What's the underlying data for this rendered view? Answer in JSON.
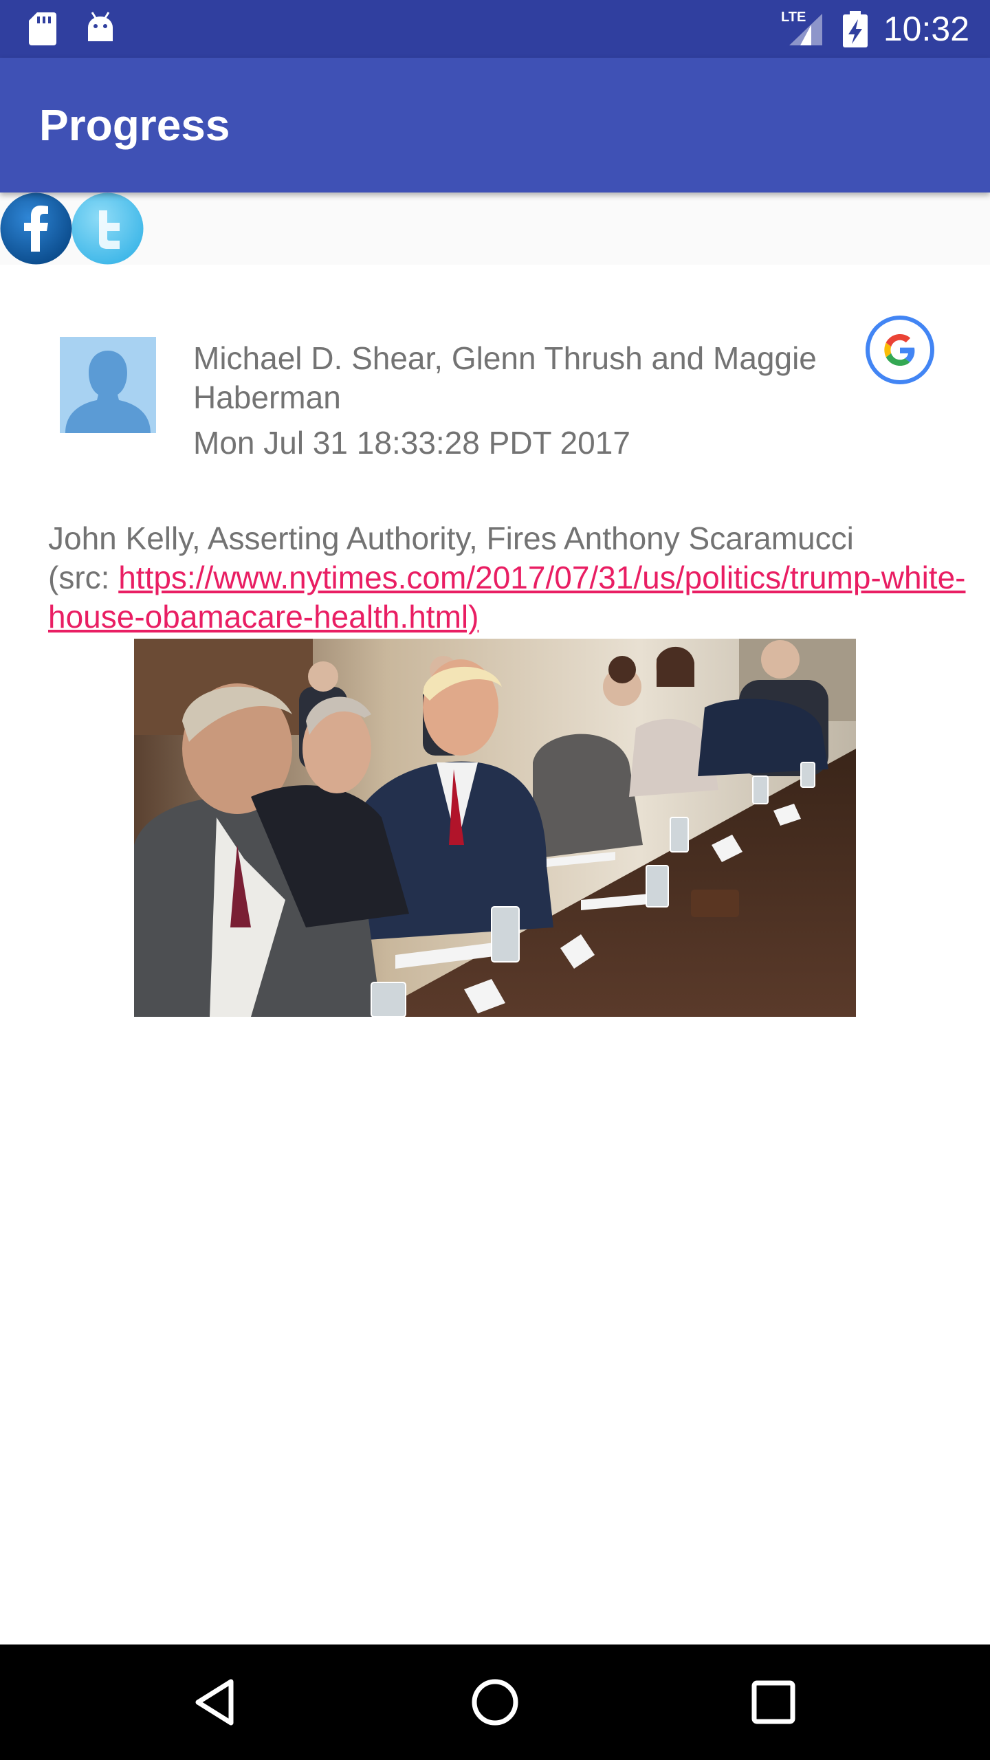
{
  "status_bar": {
    "time": "10:32",
    "network": "LTE",
    "icons": [
      "sd-card-icon",
      "android-icon",
      "lte-signal-icon",
      "battery-charging-icon"
    ]
  },
  "app_bar": {
    "title": "Progress"
  },
  "share": {
    "facebook_icon": "facebook-icon",
    "twitter_icon": "twitter-icon"
  },
  "article": {
    "avatar_icon": "person-avatar-icon",
    "author": "Michael D. Shear, Glenn Thrush and Maggie Haberman",
    "date": "Mon Jul 31 18:33:28 PDT 2017",
    "source_icon": "google-icon",
    "headline": "John Kelly, Asserting Authority, Fires Anthony Scaramucci",
    "src_prefix": "(src: ",
    "link_text": "https://www.nytimes.com/2017/07/31/us/politics/trump-white-house-obamacare-health.html)",
    "image": "cabinet-meeting-photo"
  },
  "nav_bar": {
    "icons": [
      "back-icon",
      "home-icon",
      "recents-icon"
    ]
  },
  "colors": {
    "status_bar": "#303f9f",
    "app_bar": "#3f51b5",
    "link": "#e91e63",
    "text": "#737373",
    "facebook": "#0d5ea8",
    "twitter": "#55c8f0"
  }
}
